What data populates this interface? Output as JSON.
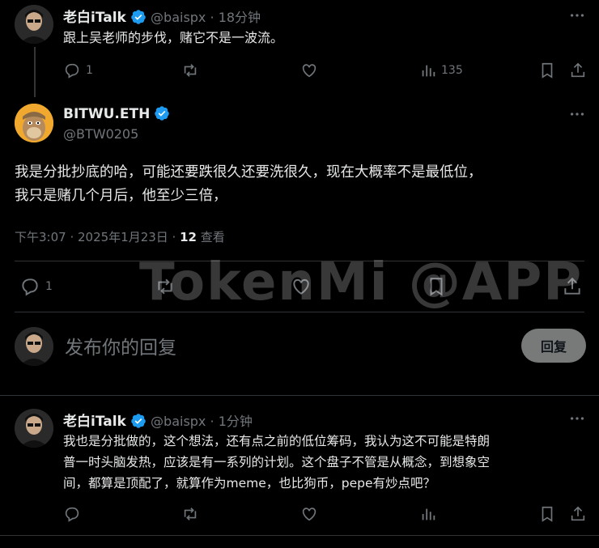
{
  "colors": {
    "background": "#000000",
    "text": "#e7e9ea",
    "muted": "#71767b",
    "accent": "#1d9bf0",
    "divider": "#2f3336"
  },
  "parent_tweet": {
    "name": "老白iTalk",
    "handle": "@baispx",
    "separator": "·",
    "time": "18分钟",
    "text": "跟上吴老师的步伐，赌它不是一波流。",
    "reply_count": "1",
    "views": "135"
  },
  "main_tweet": {
    "name": "BITWU.ETH",
    "handle": "@BTW0205",
    "text_line1": "我是分批抄底的哈，可能还要跌很久还要洗很久，现在大概率不是最低位，",
    "text_line2": "我只是赌几个月后，他至少三倍，",
    "timestamp": "下午3:07 · 2025年1月23日 · ",
    "view_count": "12",
    "view_label": " 查看",
    "reply_count": "1"
  },
  "watermark": "TokenMi @APP",
  "compose": {
    "placeholder": "发布你的回复",
    "button": "回复"
  },
  "reply_tweet": {
    "name": "老白iTalk",
    "handle": "@baispx",
    "separator": "·",
    "time": "1分钟",
    "text_line1": "我也是分批做的，这个想法，还有点之前的低位筹码，我认为这不可能是特朗",
    "text_line2": "普一时头脑发热，应该是有一系列的计划。这个盘子不管是从概念，到想象空",
    "text_line3": "间，都算是顶配了，就算作为meme，也比狗币，pepe有炒点吧？"
  },
  "icons": [
    "more-icon",
    "reply-icon",
    "retweet-icon",
    "like-icon",
    "views-icon",
    "bookmark-icon",
    "share-icon",
    "verified-icon"
  ]
}
